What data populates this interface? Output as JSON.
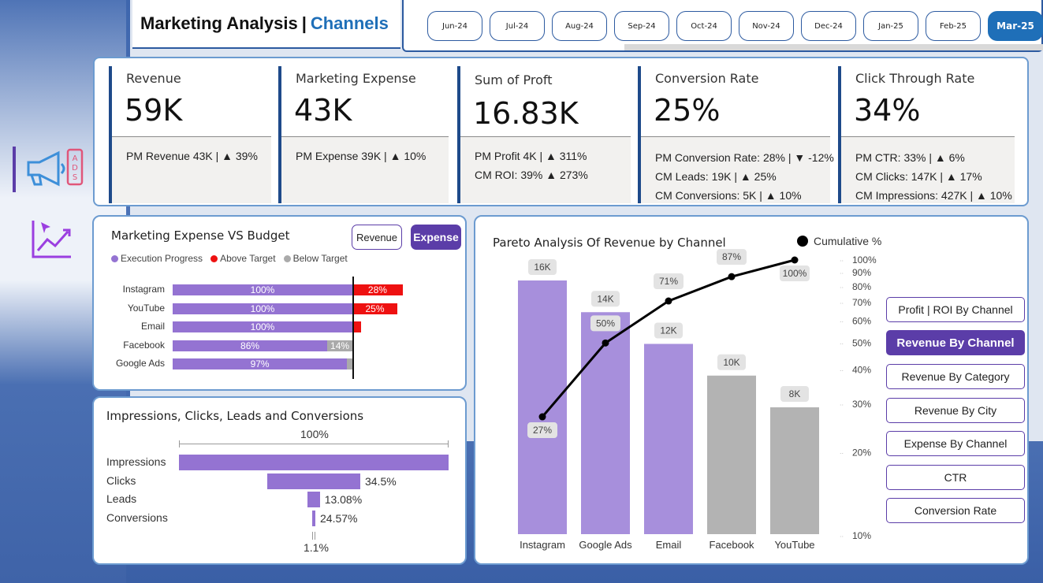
{
  "header": {
    "title": "Marketing Analysis",
    "separator": "|",
    "subtitle": "Channels"
  },
  "months": [
    {
      "label": "Jun-24",
      "active": false
    },
    {
      "label": "Jul-24",
      "active": false
    },
    {
      "label": "Aug-24",
      "active": false
    },
    {
      "label": "Sep-24",
      "active": false
    },
    {
      "label": "Oct-24",
      "active": false
    },
    {
      "label": "Nov-24",
      "active": false
    },
    {
      "label": "Dec-24",
      "active": false
    },
    {
      "label": "Jan-25",
      "active": false
    },
    {
      "label": "Feb-25",
      "active": false
    },
    {
      "label": "Mar-25",
      "active": true
    }
  ],
  "sidebar": {
    "items": [
      {
        "icon": "megaphone-ads-icon",
        "active": true
      },
      {
        "icon": "analytics-chart-icon",
        "active": false
      }
    ]
  },
  "kpis": [
    {
      "label": "Revenue",
      "value": "59K",
      "lines": [
        "PM Revenue 43K | ▲ 39%"
      ]
    },
    {
      "label": "Marketing Expense",
      "value": "43K",
      "lines": [
        "PM Expense 39K | ▲ 10%"
      ]
    },
    {
      "label": "Sum of Proft",
      "value": "16.83K",
      "lines": [
        "PM Profit 4K | ▲ 311%",
        "CM ROI: 39% ▲ 273%"
      ]
    },
    {
      "label": "Conversion Rate",
      "value": "25%",
      "lines": [
        "PM Conversion Rate: 28% | ▼ -12%",
        "CM Leads: 19K | ▲ 25%",
        "CM Conversions: 5K | ▲ 10%"
      ]
    },
    {
      "label": "Click Through Rate",
      "value": "34%",
      "lines": [
        "PM CTR: 33% | ▲ 6%",
        "CM Clicks: 147K | ▲ 17%",
        "CM Impressions: 427K | ▲ 10%"
      ]
    }
  ],
  "expense_vs_budget": {
    "title": "Marketing Expense VS Budget",
    "toggle_revenue": "Revenue",
    "toggle_expense": "Expense",
    "legend": [
      {
        "label": "Execution Progress",
        "color": "#9473d2"
      },
      {
        "label": "Above Target",
        "color": "#ee1111"
      },
      {
        "label": "Below Target",
        "color": "#aaaaaa"
      }
    ],
    "colors": {
      "progress": "#9473d2",
      "above": "#ee1111",
      "below": "#aaaaaa"
    },
    "rows": [
      {
        "channel": "Instagram",
        "progress": 100,
        "progress_label": "100%",
        "above": 28,
        "above_label": "28%",
        "below": 0,
        "below_label": ""
      },
      {
        "channel": "YouTube",
        "progress": 100,
        "progress_label": "100%",
        "above": 25,
        "above_label": "25%",
        "below": 0,
        "below_label": ""
      },
      {
        "channel": "Email",
        "progress": 100,
        "progress_label": "100%",
        "above": 5,
        "above_label": "",
        "below": 0,
        "below_label": ""
      },
      {
        "channel": "Facebook",
        "progress": 86,
        "progress_label": "86%",
        "above": 0,
        "above_label": "",
        "below": 14,
        "below_label": "14%"
      },
      {
        "channel": "Google Ads",
        "progress": 97,
        "progress_label": "97%",
        "above": 0,
        "above_label": "",
        "below": 3,
        "below_label": ""
      }
    ]
  },
  "funnel": {
    "title": "Impressions, Clicks, Leads and Conversions",
    "top_label": "100%",
    "bottom_label": "1.1%",
    "stages": [
      {
        "label": "Impressions",
        "value": 100,
        "value_label": ""
      },
      {
        "label": "Clicks",
        "value": 34.5,
        "value_label": "34.5%"
      },
      {
        "label": "Leads",
        "value": 4.5,
        "value_label": "13.08%"
      },
      {
        "label": "Conversions",
        "value": 1.1,
        "value_label": "24.57%"
      }
    ]
  },
  "chart_data": {
    "type": "bar",
    "title": "Pareto Analysis Of Revenue by Channel",
    "legend": "Cumulative %",
    "legend_position": "top-right",
    "categories": [
      "Instagram",
      "Google Ads",
      "Email",
      "Facebook",
      "YouTube"
    ],
    "values": [
      16,
      14,
      12,
      10,
      8
    ],
    "value_labels": [
      "16K",
      "14K",
      "12K",
      "10K",
      "8K"
    ],
    "cumulative": [
      27,
      50,
      71,
      87,
      100
    ],
    "cumulative_labels": [
      "27%",
      "50%",
      "71%",
      "87%",
      "100%"
    ],
    "bar_colors": [
      "#a78fdc",
      "#a78fdc",
      "#a78fdc",
      "#b3b3b3",
      "#b3b3b3"
    ],
    "ylim": [
      0,
      16
    ],
    "y2_ticks": [
      "100%",
      "90%",
      "80%",
      "70%",
      "60%",
      "50%",
      "40%",
      "30%",
      "20%",
      "10%"
    ],
    "y2_tick_values": [
      100,
      90,
      80,
      70,
      60,
      50,
      40,
      30,
      20,
      10
    ],
    "y2_scale": "log"
  },
  "nav_buttons": [
    {
      "label": "Profit | ROI By Channel",
      "active": false
    },
    {
      "label": "Revenue By Channel",
      "active": true
    },
    {
      "label": "Revenue By Category",
      "active": false
    },
    {
      "label": "Revenue By City",
      "active": false
    },
    {
      "label": "Expense By Channel",
      "active": false
    },
    {
      "label": "CTR",
      "active": false
    },
    {
      "label": "Conversion Rate",
      "active": false
    }
  ]
}
